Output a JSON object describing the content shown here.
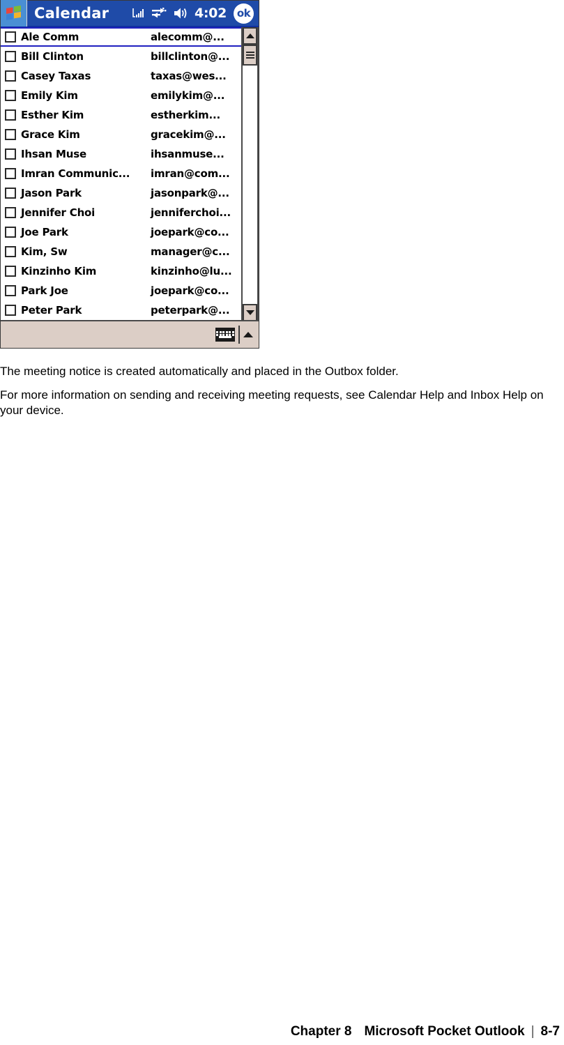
{
  "pda": {
    "titlebar": {
      "start_icon": "windows-flag-icon",
      "title": "Calendar",
      "signal_icon": "signal-strength-icon",
      "connection_icon": "connectivity-icon",
      "volume_icon": "speaker-volume-icon",
      "time": "4:02",
      "ok_label": "ok"
    },
    "list": {
      "rows": [
        {
          "name": "Ale Comm",
          "email": "alecomm@...",
          "checked": false,
          "selected": true
        },
        {
          "name": "Bill Clinton",
          "email": "billclinton@...",
          "checked": false,
          "selected": false
        },
        {
          "name": "Casey Taxas",
          "email": "taxas@wes...",
          "checked": false,
          "selected": false
        },
        {
          "name": "Emily Kim",
          "email": "emilykim@...",
          "checked": false,
          "selected": false
        },
        {
          "name": "Esther Kim",
          "email": "estherkim...",
          "checked": false,
          "selected": false
        },
        {
          "name": "Grace Kim",
          "email": "gracekim@...",
          "checked": false,
          "selected": false
        },
        {
          "name": "Ihsan Muse",
          "email": "ihsanmuse...",
          "checked": false,
          "selected": false
        },
        {
          "name": "Imran Communic...",
          "email": "imran@com...",
          "checked": false,
          "selected": false
        },
        {
          "name": "Jason Park",
          "email": "jasonpark@...",
          "checked": false,
          "selected": false
        },
        {
          "name": "Jennifer Choi",
          "email": "jenniferchoi...",
          "checked": false,
          "selected": false
        },
        {
          "name": "Joe Park",
          "email": "joepark@co...",
          "checked": false,
          "selected": false
        },
        {
          "name": "Kim, Sw",
          "email": "manager@c...",
          "checked": false,
          "selected": false
        },
        {
          "name": "Kinzinho Kim",
          "email": "kinzinho@lu...",
          "checked": false,
          "selected": false
        },
        {
          "name": "Park Joe",
          "email": "joepark@co...",
          "checked": false,
          "selected": false
        },
        {
          "name": "Peter Park",
          "email": "peterpark@...",
          "checked": false,
          "selected": false
        }
      ]
    },
    "scrollbar": {
      "up_icon": "scroll-up-arrow-icon",
      "down_icon": "scroll-down-arrow-icon",
      "thumb": "scrollbar-thumb"
    },
    "taskbar": {
      "sip_icon": "soft-keyboard-icon",
      "sip_arrow_icon": "sip-selector-up-arrow-icon"
    }
  },
  "content": {
    "paragraphs": [
      "The meeting notice is created automatically and placed in the Outbox folder.",
      "For more information on sending and receiving meeting requests, see Calendar Help and Inbox Help on your device."
    ]
  },
  "footer": {
    "chapter": "Chapter 8",
    "section": "Microsoft Pocket Outlook",
    "separator": "|",
    "page": "8-7"
  },
  "colors": {
    "titlebar_blue": "#1f4ba8",
    "start_blue": "#4a8fd4",
    "taskbar_beige": "#dccec6",
    "selection_blue": "#2020c0"
  }
}
